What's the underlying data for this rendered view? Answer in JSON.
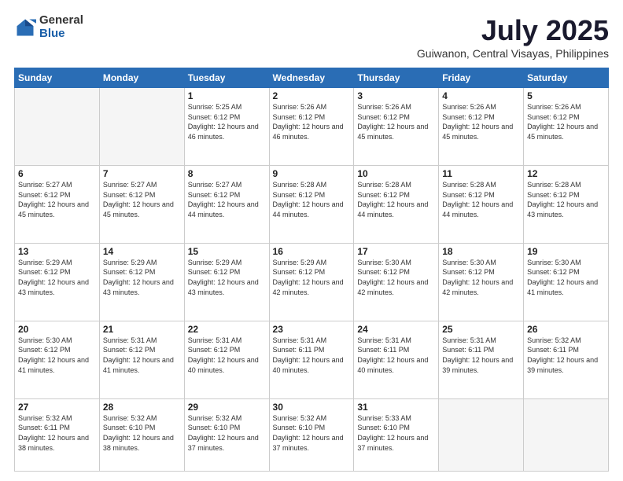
{
  "logo": {
    "general": "General",
    "blue": "Blue"
  },
  "header": {
    "month": "July 2025",
    "location": "Guiwanon, Central Visayas, Philippines"
  },
  "days_of_week": [
    "Sunday",
    "Monday",
    "Tuesday",
    "Wednesday",
    "Thursday",
    "Friday",
    "Saturday"
  ],
  "weeks": [
    [
      {
        "day": "",
        "info": ""
      },
      {
        "day": "",
        "info": ""
      },
      {
        "day": "1",
        "info": "Sunrise: 5:25 AM\nSunset: 6:12 PM\nDaylight: 12 hours and 46 minutes."
      },
      {
        "day": "2",
        "info": "Sunrise: 5:26 AM\nSunset: 6:12 PM\nDaylight: 12 hours and 46 minutes."
      },
      {
        "day": "3",
        "info": "Sunrise: 5:26 AM\nSunset: 6:12 PM\nDaylight: 12 hours and 45 minutes."
      },
      {
        "day": "4",
        "info": "Sunrise: 5:26 AM\nSunset: 6:12 PM\nDaylight: 12 hours and 45 minutes."
      },
      {
        "day": "5",
        "info": "Sunrise: 5:26 AM\nSunset: 6:12 PM\nDaylight: 12 hours and 45 minutes."
      }
    ],
    [
      {
        "day": "6",
        "info": "Sunrise: 5:27 AM\nSunset: 6:12 PM\nDaylight: 12 hours and 45 minutes."
      },
      {
        "day": "7",
        "info": "Sunrise: 5:27 AM\nSunset: 6:12 PM\nDaylight: 12 hours and 45 minutes."
      },
      {
        "day": "8",
        "info": "Sunrise: 5:27 AM\nSunset: 6:12 PM\nDaylight: 12 hours and 44 minutes."
      },
      {
        "day": "9",
        "info": "Sunrise: 5:28 AM\nSunset: 6:12 PM\nDaylight: 12 hours and 44 minutes."
      },
      {
        "day": "10",
        "info": "Sunrise: 5:28 AM\nSunset: 6:12 PM\nDaylight: 12 hours and 44 minutes."
      },
      {
        "day": "11",
        "info": "Sunrise: 5:28 AM\nSunset: 6:12 PM\nDaylight: 12 hours and 44 minutes."
      },
      {
        "day": "12",
        "info": "Sunrise: 5:28 AM\nSunset: 6:12 PM\nDaylight: 12 hours and 43 minutes."
      }
    ],
    [
      {
        "day": "13",
        "info": "Sunrise: 5:29 AM\nSunset: 6:12 PM\nDaylight: 12 hours and 43 minutes."
      },
      {
        "day": "14",
        "info": "Sunrise: 5:29 AM\nSunset: 6:12 PM\nDaylight: 12 hours and 43 minutes."
      },
      {
        "day": "15",
        "info": "Sunrise: 5:29 AM\nSunset: 6:12 PM\nDaylight: 12 hours and 43 minutes."
      },
      {
        "day": "16",
        "info": "Sunrise: 5:29 AM\nSunset: 6:12 PM\nDaylight: 12 hours and 42 minutes."
      },
      {
        "day": "17",
        "info": "Sunrise: 5:30 AM\nSunset: 6:12 PM\nDaylight: 12 hours and 42 minutes."
      },
      {
        "day": "18",
        "info": "Sunrise: 5:30 AM\nSunset: 6:12 PM\nDaylight: 12 hours and 42 minutes."
      },
      {
        "day": "19",
        "info": "Sunrise: 5:30 AM\nSunset: 6:12 PM\nDaylight: 12 hours and 41 minutes."
      }
    ],
    [
      {
        "day": "20",
        "info": "Sunrise: 5:30 AM\nSunset: 6:12 PM\nDaylight: 12 hours and 41 minutes."
      },
      {
        "day": "21",
        "info": "Sunrise: 5:31 AM\nSunset: 6:12 PM\nDaylight: 12 hours and 41 minutes."
      },
      {
        "day": "22",
        "info": "Sunrise: 5:31 AM\nSunset: 6:12 PM\nDaylight: 12 hours and 40 minutes."
      },
      {
        "day": "23",
        "info": "Sunrise: 5:31 AM\nSunset: 6:11 PM\nDaylight: 12 hours and 40 minutes."
      },
      {
        "day": "24",
        "info": "Sunrise: 5:31 AM\nSunset: 6:11 PM\nDaylight: 12 hours and 40 minutes."
      },
      {
        "day": "25",
        "info": "Sunrise: 5:31 AM\nSunset: 6:11 PM\nDaylight: 12 hours and 39 minutes."
      },
      {
        "day": "26",
        "info": "Sunrise: 5:32 AM\nSunset: 6:11 PM\nDaylight: 12 hours and 39 minutes."
      }
    ],
    [
      {
        "day": "27",
        "info": "Sunrise: 5:32 AM\nSunset: 6:11 PM\nDaylight: 12 hours and 38 minutes."
      },
      {
        "day": "28",
        "info": "Sunrise: 5:32 AM\nSunset: 6:10 PM\nDaylight: 12 hours and 38 minutes."
      },
      {
        "day": "29",
        "info": "Sunrise: 5:32 AM\nSunset: 6:10 PM\nDaylight: 12 hours and 37 minutes."
      },
      {
        "day": "30",
        "info": "Sunrise: 5:32 AM\nSunset: 6:10 PM\nDaylight: 12 hours and 37 minutes."
      },
      {
        "day": "31",
        "info": "Sunrise: 5:33 AM\nSunset: 6:10 PM\nDaylight: 12 hours and 37 minutes."
      },
      {
        "day": "",
        "info": ""
      },
      {
        "day": "",
        "info": ""
      }
    ]
  ]
}
